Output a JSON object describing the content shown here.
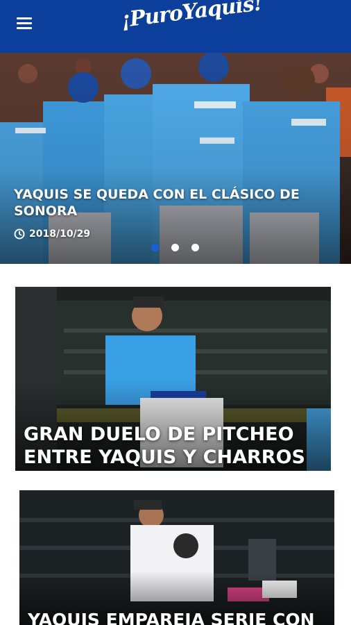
{
  "header": {
    "menu_icon": "hamburger-menu-icon",
    "logo_text": "¡PuroYaquis!",
    "background": "#0b3f9b"
  },
  "hero": {
    "title": "YAQUIS SE QUEDA CON EL CLÁSICO DE SONORA",
    "date": "2018/10/29",
    "date_icon": "clock-icon",
    "slide_count": 3,
    "active_slide": 1,
    "dot_active_color": "#1660d8"
  },
  "articles": [
    {
      "title": "GRAN DUELO DE PITCHEO ENTRE YAQUIS Y CHARROS"
    },
    {
      "title": "YAQUIS EMPAREJA SERIE CON"
    }
  ]
}
